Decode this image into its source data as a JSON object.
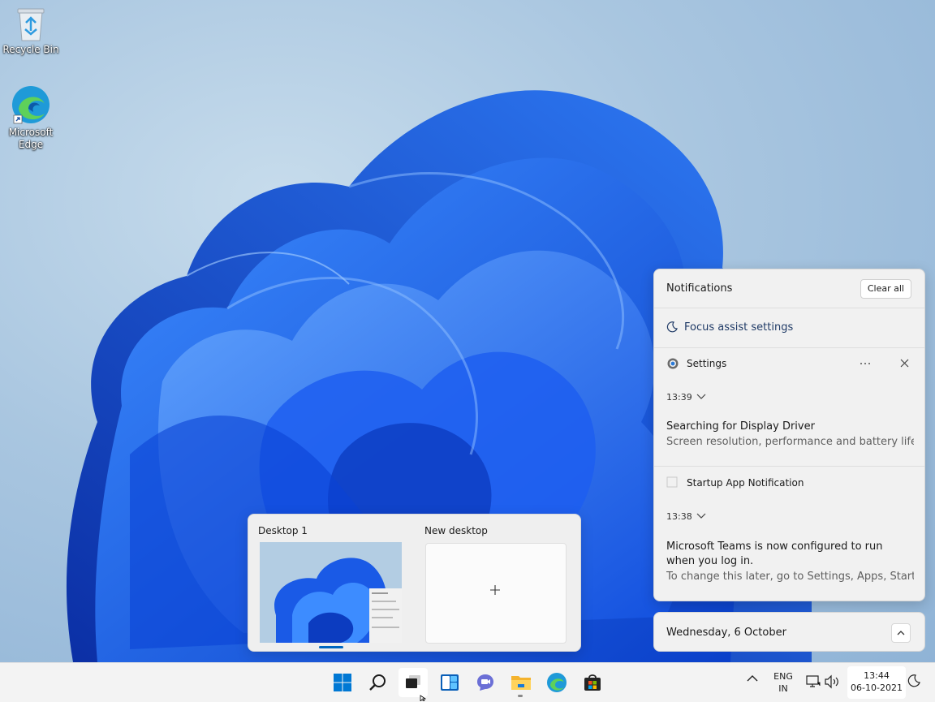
{
  "desktop": {
    "icons": [
      {
        "label": "Recycle Bin",
        "icon": "recycle-bin-icon"
      },
      {
        "label": "Microsoft Edge",
        "icon": "edge-icon"
      }
    ]
  },
  "notification_center": {
    "title": "Notifications",
    "clear_all_label": "Clear all",
    "focus_assist_label": "Focus assist settings",
    "notifications": [
      {
        "app": "Settings",
        "time": "13:39",
        "heading": "Searching for Display Driver",
        "body": "Screen resolution, performance and battery life m"
      },
      {
        "app": "Startup App Notification",
        "time": "13:38",
        "heading": "Microsoft Teams is now configured to run when you log in.",
        "body": "To change this later, go to Settings, Apps, Startup"
      }
    ]
  },
  "calendar": {
    "date_label": "Wednesday, 6 October"
  },
  "virtual_desktops": {
    "items": [
      {
        "label": "Desktop 1",
        "selected": true
      },
      {
        "label": "New desktop"
      }
    ]
  },
  "taskbar": {
    "apps": [
      "Start",
      "Search",
      "Task View",
      "Widgets",
      "Chat",
      "File Explorer",
      "Microsoft Edge",
      "Microsoft Store"
    ],
    "language": {
      "line1": "ENG",
      "line2": "IN"
    },
    "clock": {
      "time": "13:44",
      "date": "06-10-2021"
    }
  },
  "colors": {
    "accent": "#0067c0",
    "taskbar": "#f3f3f3",
    "panel": "#f1f1f1"
  }
}
